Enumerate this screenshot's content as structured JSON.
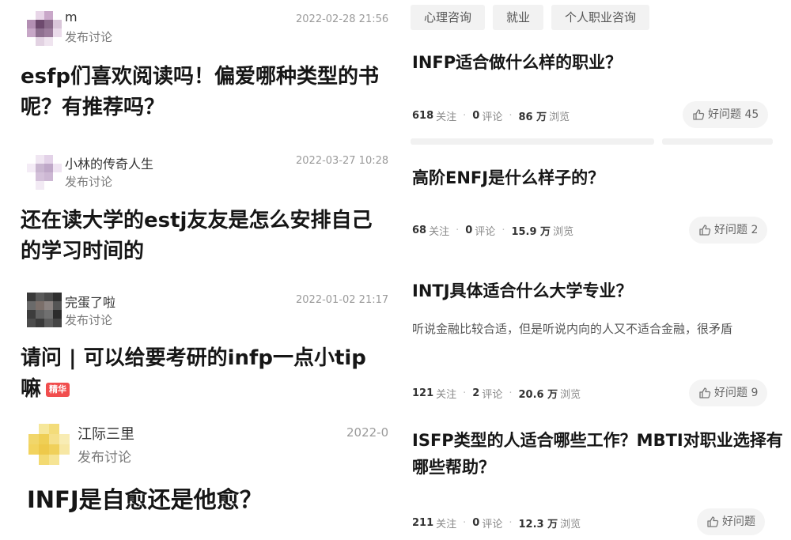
{
  "posts": [
    {
      "author": "m",
      "action": "发布讨论",
      "date": "2022-02-28 21:56",
      "title": "esfp们喜欢阅读吗！偏爱哪种类型的书呢？有推荐吗？",
      "avatar_colors": [
        "#ffffff",
        "#e8d6e8",
        "#c9a8c9",
        "#ffffff",
        "#b38fb3",
        "#6e4a6e",
        "#8a6a8a",
        "#d9c6d9",
        "#c7a7c7",
        "#8f7090",
        "#9d7d9d",
        "#eadbea",
        "#ffffff",
        "#e2d2e2",
        "#efe4ef",
        "#ffffff"
      ]
    },
    {
      "author": "小林的传奇人生",
      "action": "发布讨论",
      "date": "2022-03-27 10:28",
      "title": "还在读大学的estj友友是怎么安排自己的学习时间的",
      "avatar_colors": [
        "#ffffff",
        "#f0e6f2",
        "#e3d2e8",
        "#ffffff",
        "#f4ecf6",
        "#c9b6d0",
        "#bfa8c8",
        "#efe4f2",
        "#ffffff",
        "#d4c1da",
        "#cdb8d4",
        "#ffffff",
        "#ffffff",
        "#f2eaf4",
        "#ffffff",
        "#ffffff"
      ]
    },
    {
      "author": "完蛋了啦",
      "action": "发布讨论",
      "date": "2022-01-02 21:17",
      "title": "请问 | 可以给要考研的infp一点小tip嘛",
      "badge": "精华",
      "avatar_colors": [
        "#3a3a3a",
        "#5a5a5a",
        "#4a4a4a",
        "#2f2f2f",
        "#6a6a6a",
        "#7b6f6a",
        "#8a8280",
        "#555555",
        "#3d3d3d",
        "#626262",
        "#707070",
        "#2c2c2c",
        "#4c4c4c",
        "#3a3a3a",
        "#5c5c5c",
        "#454545"
      ]
    },
    {
      "author": "江际三里",
      "action": "发布讨论",
      "date": "2022-0",
      "title": "INFJ是自愈还是他愈？",
      "avatar_colors": [
        "#ffffff",
        "#f6e79a",
        "#f3dc7a",
        "#ffffff",
        "#f1d66a",
        "#efcf55",
        "#f5e08a",
        "#f8ecb4",
        "#f2d35e",
        "#eec94a",
        "#f0d05a",
        "#f7e7a4",
        "#ffffff",
        "#f3da72",
        "#f6e494",
        "#ffffff"
      ]
    }
  ],
  "tags": [
    "心理咨询",
    "就业",
    "个人职业咨询"
  ],
  "questions": [
    {
      "title": "INFP适合做什么样的职业？",
      "excerpt": "",
      "follow_count": "618",
      "follow_label": "关注",
      "comment_count": "0",
      "comment_label": "评论",
      "view_count": "86 万",
      "view_label": "浏览",
      "good_label": "好问题 45"
    },
    {
      "title": "高阶ENFJ是什么样子的？",
      "excerpt": "",
      "follow_count": "68",
      "follow_label": "关注",
      "comment_count": "0",
      "comment_label": "评论",
      "view_count": "15.9 万",
      "view_label": "浏览",
      "good_label": "好问题 2"
    },
    {
      "title": "INTJ具体适合什么大学专业？",
      "excerpt": "听说金融比较合适，但是听说内向的人又不适合金融，很矛盾",
      "follow_count": "121",
      "follow_label": "关注",
      "comment_count": "2",
      "comment_label": "评论",
      "view_count": "20.6 万",
      "view_label": "浏览",
      "good_label": "好问题 9"
    },
    {
      "title": "ISFP类型的人适合哪些工作？MBTI对职业选择有哪些帮助？",
      "excerpt": "",
      "follow_count": "211",
      "follow_label": "关注",
      "comment_count": "0",
      "comment_label": "评论",
      "view_count": "12.3 万",
      "view_label": "浏览",
      "good_label": "好问题"
    }
  ],
  "icons": {
    "good_button": "thumbs-up-icon"
  }
}
